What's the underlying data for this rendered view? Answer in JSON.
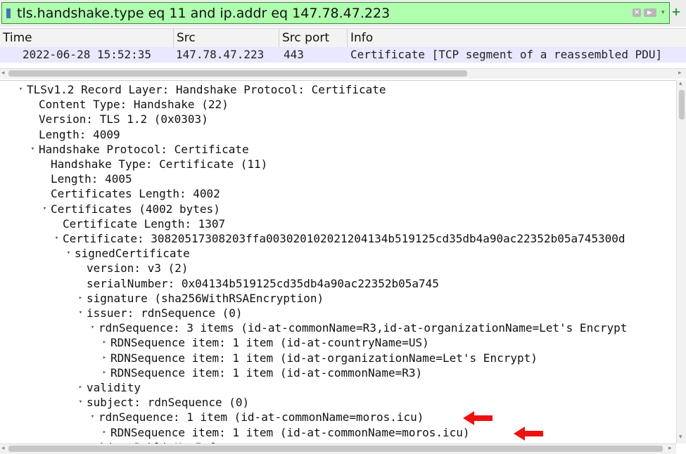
{
  "filter": {
    "value": "tls.handshake.type eq 11 and ip.addr eq 147.78.47.223"
  },
  "columns": [
    "Time",
    "Src",
    "Src port",
    "Info"
  ],
  "packet": {
    "time": "2022-06-28 15:52:35",
    "src": "147.78.47.223",
    "src_port": "443",
    "info": "Certificate [TCP segment of a reassembled PDU]"
  },
  "tree": [
    {
      "text": "TLSv1.2 Record Layer: Handshake Protocol: Certificate",
      "level": 0,
      "toggle": "expanded"
    },
    {
      "text": "Content Type: Handshake (22)",
      "level": 1,
      "toggle": "none"
    },
    {
      "text": "Version: TLS 1.2 (0x0303)",
      "level": 1,
      "toggle": "none"
    },
    {
      "text": "Length: 4009",
      "level": 1,
      "toggle": "none"
    },
    {
      "text": "Handshake Protocol: Certificate",
      "level": 1,
      "toggle": "expanded"
    },
    {
      "text": "Handshake Type: Certificate (11)",
      "level": 2,
      "toggle": "none"
    },
    {
      "text": "Length: 4005",
      "level": 2,
      "toggle": "none"
    },
    {
      "text": "Certificates Length: 4002",
      "level": 2,
      "toggle": "none"
    },
    {
      "text": "Certificates (4002 bytes)",
      "level": 2,
      "toggle": "expanded"
    },
    {
      "text": "Certificate Length: 1307",
      "level": 3,
      "toggle": "none"
    },
    {
      "text": "Certificate: 30820517308203ffa003020102021204134b519125cd35db4a90ac22352b05a745300d",
      "level": 3,
      "toggle": "expanded"
    },
    {
      "text": "signedCertificate",
      "level": 4,
      "toggle": "expanded"
    },
    {
      "text": "version: v3 (2)",
      "level": 5,
      "toggle": "none"
    },
    {
      "text": "serialNumber: 0x04134b519125cd35db4a90ac22352b05a745",
      "level": 5,
      "toggle": "none"
    },
    {
      "text": "signature (sha256WithRSAEncryption)",
      "level": 5,
      "toggle": "collapsed"
    },
    {
      "text": "issuer: rdnSequence (0)",
      "level": 5,
      "toggle": "expanded"
    },
    {
      "text": "rdnSequence: 3 items (id-at-commonName=R3,id-at-organizationName=Let's Encrypt",
      "level": 6,
      "toggle": "expanded"
    },
    {
      "text": "RDNSequence item: 1 item (id-at-countryName=US)",
      "level": 7,
      "toggle": "collapsed"
    },
    {
      "text": "RDNSequence item: 1 item (id-at-organizationName=Let's Encrypt)",
      "level": 7,
      "toggle": "collapsed"
    },
    {
      "text": "RDNSequence item: 1 item (id-at-commonName=R3)",
      "level": 7,
      "toggle": "collapsed"
    },
    {
      "text": "validity",
      "level": 5,
      "toggle": "collapsed"
    },
    {
      "text": "subject: rdnSequence (0)",
      "level": 5,
      "toggle": "expanded"
    },
    {
      "text": "rdnSequence: 1 item (id-at-commonName=moros.icu)",
      "level": 6,
      "toggle": "expanded"
    },
    {
      "text": "RDNSequence item: 1 item (id-at-commonName=moros.icu)",
      "level": 7,
      "toggle": "collapsed"
    },
    {
      "text": "subjectPublicKeyInfo",
      "level": 5,
      "toggle": "collapsed"
    }
  ],
  "colors": {
    "filter_bg": "#afffaf",
    "selected_row": "#e8e8ff",
    "annotation_arrow": "#ee1111"
  },
  "icons": [
    "bookmark-icon",
    "clear-filter-icon",
    "apply-filter-icon",
    "filter-dropdown-icon",
    "add-filter-icon",
    "expand-arrow-icon",
    "collapse-arrow-icon",
    "red-arrow-icon"
  ]
}
